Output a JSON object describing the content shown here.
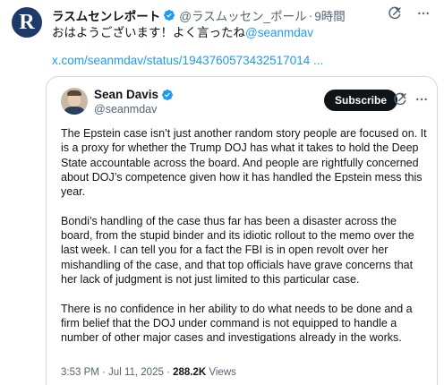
{
  "post": {
    "avatar_letter": "R",
    "author_name": "ラスムセンレポート",
    "handle": "@ラスムッセン_ポール",
    "separator": "·",
    "time": "9時間",
    "text_before": "おはようございます！よく言ったね",
    "mention": "@seanmdav",
    "link": "x.com/seanmdav/status/1943760573432517014 ...",
    "icons": [
      "verified-badge-icon",
      "grok-icon",
      "more-icon"
    ]
  },
  "quote": {
    "author_name": "Sean Davis",
    "handle": "@seanmdav",
    "subscribe_label": "Subscribe",
    "paragraphs": [
      "The Epstein case isn’t just another random story people are focused on. It is a proxy for whether the Trump DOJ has what it takes to hold the Deep State accountable across the board. And people are rightfully concerned about DOJ’s competence given how it has handled the Epstein mess this year.",
      "Bondi’s handling of the case thus far has been a disaster across the board, from the stupid binder and its idiotic rollout to the memo over the last week. I can tell you for a fact the FBI is in open revolt over her mishandling of the case, and that top officials have grave concerns that her lack of judgment is not just limited to this particular case.",
      "There is no confidence in her ability to do what needs to be done and a firm belief that the DOJ under command is not equipped to handle a number of other major cases and investigations already in the works."
    ],
    "timestamp": "3:53 PM · Jul 11, 2025",
    "separator": "·",
    "views_count": "288.2K",
    "views_label": "Views"
  },
  "colors": {
    "accent": "#1d9bf0",
    "text": "#0f1419",
    "muted": "#536471",
    "border": "#cfd9de"
  }
}
